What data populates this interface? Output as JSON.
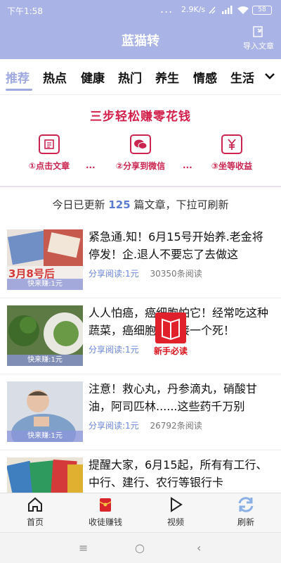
{
  "status_bar": {
    "time": "下午1:58",
    "dots": "...",
    "speed": "2.9K/s",
    "battery": "58"
  },
  "header": {
    "title": "蓝猫转",
    "import_label": "导入文章",
    "background_color": "#aab3e6"
  },
  "tabs": [
    {
      "label": "推荐",
      "active": true
    },
    {
      "label": "热点"
    },
    {
      "label": "健康"
    },
    {
      "label": "热门"
    },
    {
      "label": "养生"
    },
    {
      "label": "情感"
    },
    {
      "label": "生活"
    }
  ],
  "promo": {
    "title": "三步轻松赚零花钱",
    "separator": "···",
    "steps": [
      {
        "label": "①点击文章",
        "icon": "article-icon"
      },
      {
        "label": "②分享到微信",
        "icon": "wechat-icon"
      },
      {
        "label": "③坐等收益",
        "icon": "yen-icon"
      }
    ],
    "accent_color": "#c9254f"
  },
  "update": {
    "prefix": "今日已更新",
    "count": "125",
    "suffix": "篇文章，下拉可刷新"
  },
  "articles": [
    {
      "title": "紧急通.知！6月15号开始养.老金将停发！企.退人不要忘了去做这",
      "share": "分享阅读:1元",
      "reads": "30350条阅读",
      "earn": "快来赚:1元",
      "thumb_text": "3月8号后"
    },
    {
      "title": "人人怕癌，癌细胞怕它！经常吃这种蔬菜，癌细胞一个接一个死！",
      "share": "分享阅读:1元",
      "reads": "",
      "earn": "快来赚:1元"
    },
    {
      "title": "注意！救心丸，丹参滴丸，硝酸甘油，阿司匹林......这些药千万别",
      "share": "分享阅读:1元",
      "reads": "26792条阅读",
      "earn": "快来赚:1元"
    },
    {
      "title": "提醒大家，6月15起，所有有工行、中行、建行、农行等银行卡",
      "share": "",
      "reads": "",
      "earn": ""
    }
  ],
  "newbie_badge": "新手必读",
  "bottom_nav": [
    {
      "label": "首页",
      "icon": "home-icon"
    },
    {
      "label": "收徒赚钱",
      "icon": "red-envelope-icon"
    },
    {
      "label": "视频",
      "icon": "play-icon"
    },
    {
      "label": "刷新",
      "icon": "refresh-icon"
    }
  ],
  "system_nav": {
    "menu": "≡",
    "home": "○",
    "back": "‹"
  }
}
